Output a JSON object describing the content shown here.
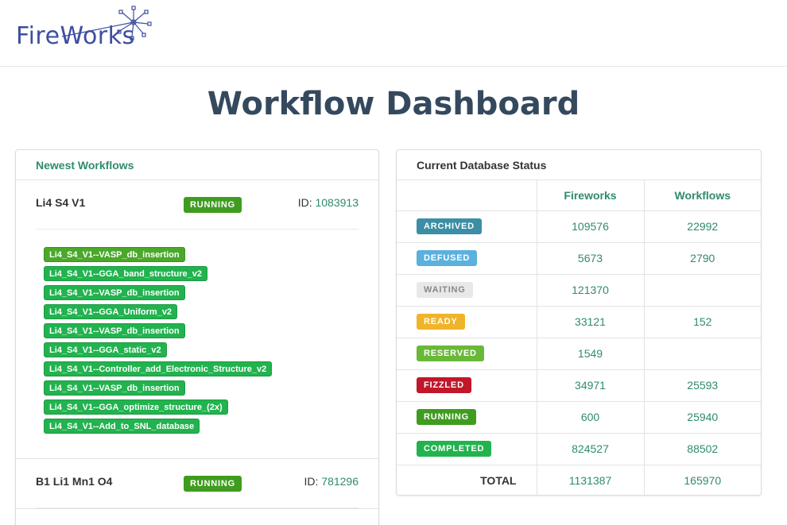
{
  "brand": {
    "logo_text": "FireWorks",
    "logo_icon": "fireworks-burst-icon"
  },
  "page": {
    "title": "Workflow Dashboard"
  },
  "newest_workflows": {
    "heading": "Newest Workflows",
    "id_label": "ID:",
    "workflows": [
      {
        "name": "Li4 S4 V1",
        "state": "RUNNING",
        "id": "1083913",
        "fireworks": [
          "Li4_S4_V1--VASP_db_insertion",
          "Li4_S4_V1--GGA_band_structure_v2",
          "Li4_S4_V1--VASP_db_insertion",
          "Li4_S4_V1--GGA_Uniform_v2",
          "Li4_S4_V1--VASP_db_insertion",
          "Li4_S4_V1--GGA_static_v2",
          "Li4_S4_V1--Controller_add_Electronic_Structure_v2",
          "Li4_S4_V1--VASP_db_insertion",
          "Li4_S4_V1--GGA_optimize_structure_(2x)",
          "Li4_S4_V1--Add_to_SNL_database"
        ]
      },
      {
        "name": "B1 Li1 Mn1 O4",
        "state": "RUNNING",
        "id": "781296"
      }
    ]
  },
  "db_status": {
    "heading": "Current Database Status",
    "columns": {
      "fireworks": "Fireworks",
      "workflows": "Workflows"
    },
    "rows": [
      {
        "state": "ARCHIVED",
        "color": "#3b8ea5",
        "fireworks": "109576",
        "workflows": "22992"
      },
      {
        "state": "DEFUSED",
        "color": "#5bb0de",
        "fireworks": "5673",
        "workflows": "2790"
      },
      {
        "state": "WAITING",
        "color": "#e8e8e8",
        "text_color": "#888888",
        "fireworks": "121370",
        "workflows": ""
      },
      {
        "state": "READY",
        "color": "#f0b429",
        "fireworks": "33121",
        "workflows": "152"
      },
      {
        "state": "RESERVED",
        "color": "#6ab838",
        "fireworks": "1549",
        "workflows": ""
      },
      {
        "state": "FIZZLED",
        "color": "#c0172b",
        "fireworks": "34971",
        "workflows": "25593"
      },
      {
        "state": "RUNNING",
        "color": "#3f9c1f",
        "fireworks": "600",
        "workflows": "25940"
      },
      {
        "state": "COMPLETED",
        "color": "#22b34f",
        "fireworks": "824527",
        "workflows": "88502"
      }
    ],
    "total": {
      "label": "TOTAL",
      "fireworks": "1131387",
      "workflows": "165970"
    }
  }
}
